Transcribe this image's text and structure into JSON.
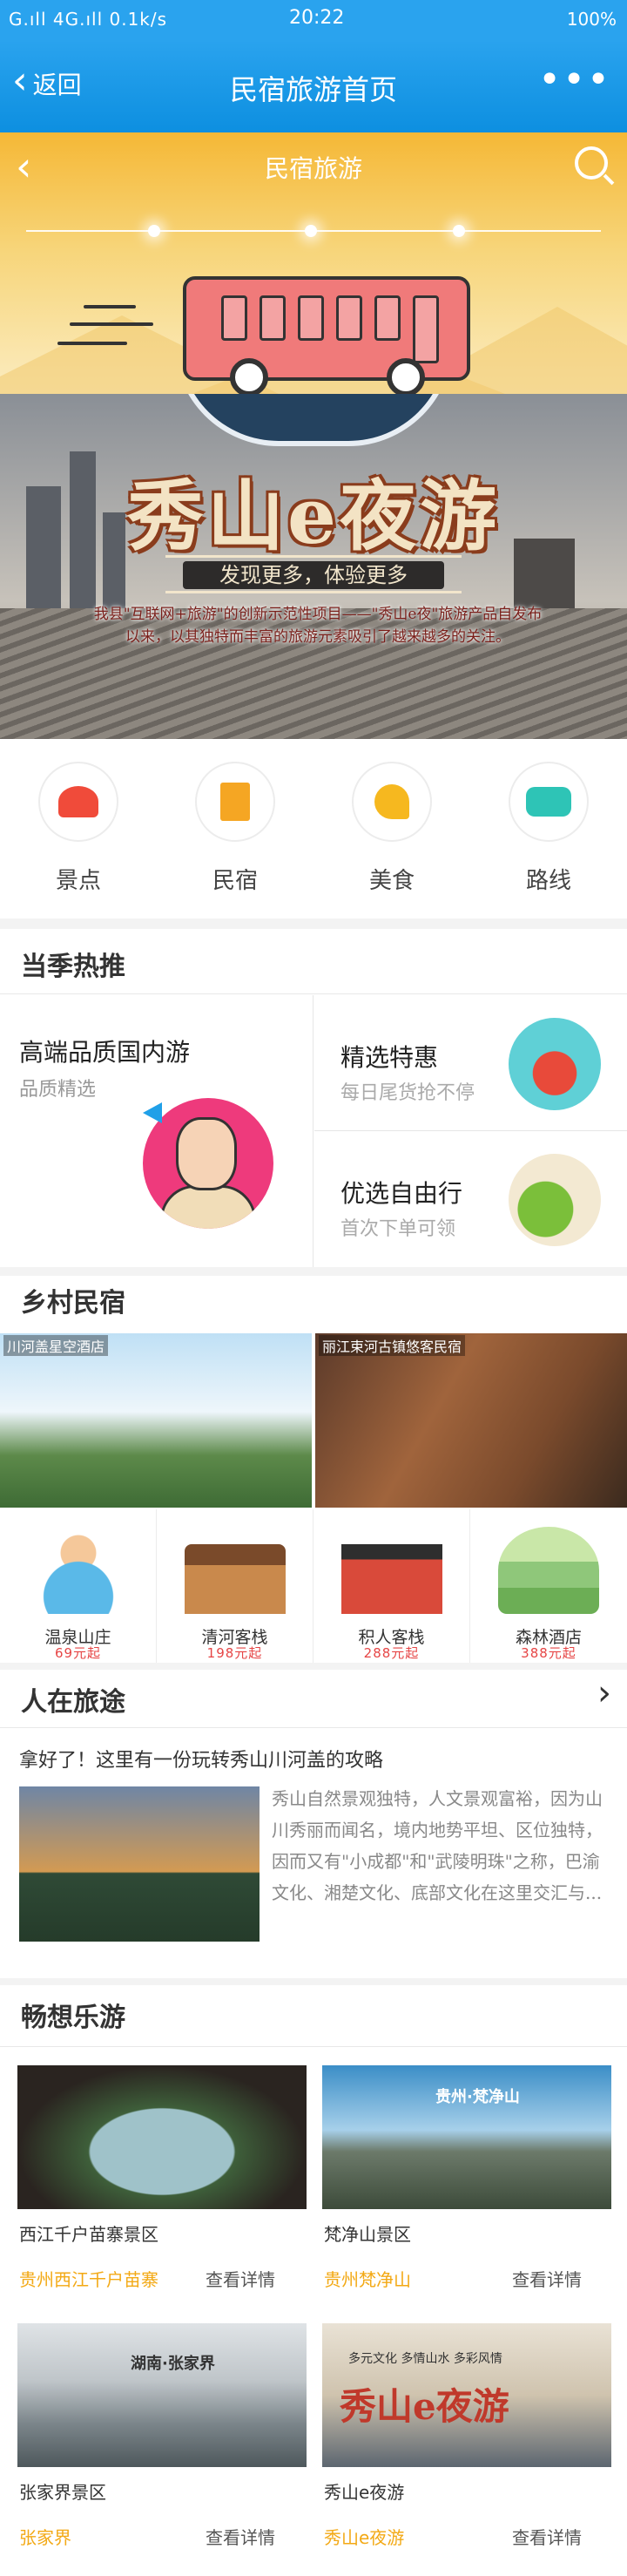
{
  "status_bar": {
    "left": "G.ıll 4G.ıll 0.1k/s",
    "time": "20:22",
    "right": "100%"
  },
  "header": {
    "back_label": "返回",
    "title": "民宿旅游首页",
    "more": "•••"
  },
  "hero": {
    "title": "民宿旅游"
  },
  "promo": {
    "title": "秀山e夜游",
    "slogan": "发现更多，体验更多",
    "desc": "我县\"互联网+旅游\"的创新示范性项目——\"秀山e夜\"旅游产品自发布以来，以其独特而丰富的旅游元素吸引了越来越多的关注。"
  },
  "categories": [
    {
      "label": "景点",
      "icon": "scenic-icon",
      "color": "#f04b3a"
    },
    {
      "label": "民宿",
      "icon": "building-icon",
      "color": "#f5a623"
    },
    {
      "label": "美食",
      "icon": "palm-icon",
      "color": "#f6b81f"
    },
    {
      "label": "路线",
      "icon": "bus-icon",
      "color": "#2ec4b6"
    }
  ],
  "hot": {
    "title": "当季热推",
    "left": {
      "title": "高端品质国内游",
      "subtitle": "品质精选"
    },
    "right": [
      {
        "title": "精选特惠",
        "subtitle": "每日尾货抢不停"
      },
      {
        "title": "优选自由行",
        "subtitle": "首次下单可领"
      }
    ]
  },
  "homestay": {
    "title": "乡村民宿",
    "banners": [
      {
        "caption": "川河盖星空酒店"
      },
      {
        "caption": "丽江束河古镇悠客民宿"
      }
    ],
    "cards": [
      {
        "name": "温泉山庄",
        "price": "69元起"
      },
      {
        "name": "清河客栈",
        "price": "198元起"
      },
      {
        "name": "积人客栈",
        "price": "288元起"
      },
      {
        "name": "森林酒店",
        "price": "388元起"
      }
    ]
  },
  "story": {
    "title": "人在旅途",
    "more": "›",
    "headline": "拿好了！这里有一份玩转秀山川河盖的攻略",
    "body": "秀山自然景观独特，人文景观富裕，因为山川秀丽而闻名，境内地势平坦、区位独特，因而又有\"小成都\"和\"武陵明珠\"之称，巴渝文化、湘楚文化、底部文化在这里交汇与..."
  },
  "spots": {
    "title": "畅想乐游",
    "items": [
      {
        "name": "西江千户苗寨景区",
        "tag": "贵州西江千户苗寨",
        "link": "查看详情"
      },
      {
        "name": "梵净山景区",
        "tag": "贵州梵净山",
        "link": "查看详情"
      },
      {
        "name": "张家界景区",
        "tag": "张家界",
        "link": "查看详情"
      },
      {
        "name": "秀山e夜游",
        "tag": "秀山e夜游",
        "link": "查看详情"
      }
    ],
    "banner_texts": [
      "贵州·梵净山",
      "湖南·张家界",
      "秀山e夜游",
      "多元文化 多情山水 多彩风情"
    ]
  }
}
